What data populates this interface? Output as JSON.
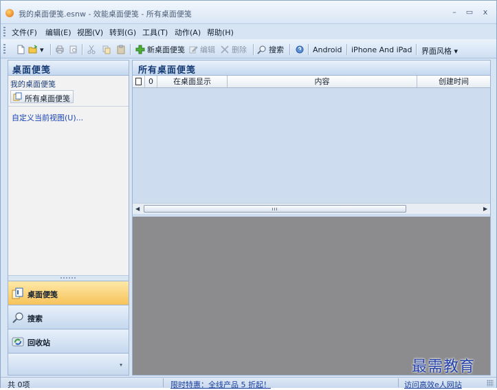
{
  "window": {
    "title": "我的桌面便笺.esnw - 效能桌面便笺 - 所有桌面便笺",
    "controls": {
      "minimize": "–",
      "maximize": "▭",
      "close": "x"
    }
  },
  "menu": [
    "文件(F)",
    "编辑(E)",
    "视图(V)",
    "转到(G)",
    "工具(T)",
    "动作(A)",
    "帮助(H)"
  ],
  "toolbar": {
    "new_note": "新桌面便笺",
    "edit": "编辑",
    "delete": "删除",
    "search": "搜索",
    "android": "Android",
    "iphone_ipad": "iPhone And iPad",
    "skin": "界面风格"
  },
  "left_panel": {
    "title": "桌面便笺",
    "group_label": "我的桌面便笺",
    "selected_item": "所有桌面便笺",
    "customize_link": "自定义当前视图(U)...",
    "nav": {
      "notes": "桌面便笺",
      "search": "搜索",
      "recycle": "回收站"
    }
  },
  "main": {
    "title": "所有桌面便笺",
    "columns": {
      "attachment": "0",
      "show_on_desktop": "在桌面显示",
      "content": "内容",
      "created": "创建时间"
    },
    "rows": [],
    "scroll_grip": "|||"
  },
  "status": {
    "count": "共 0项",
    "promo": "限时特惠：全线产品 5 折起！",
    "visit": "访问高效e人网站"
  },
  "watermark": "最需教育",
  "colors": {
    "accent": "#163b74",
    "selected_nav": "#f6c35a",
    "link": "#1842b8",
    "preview_bg": "#8c8c8e"
  }
}
